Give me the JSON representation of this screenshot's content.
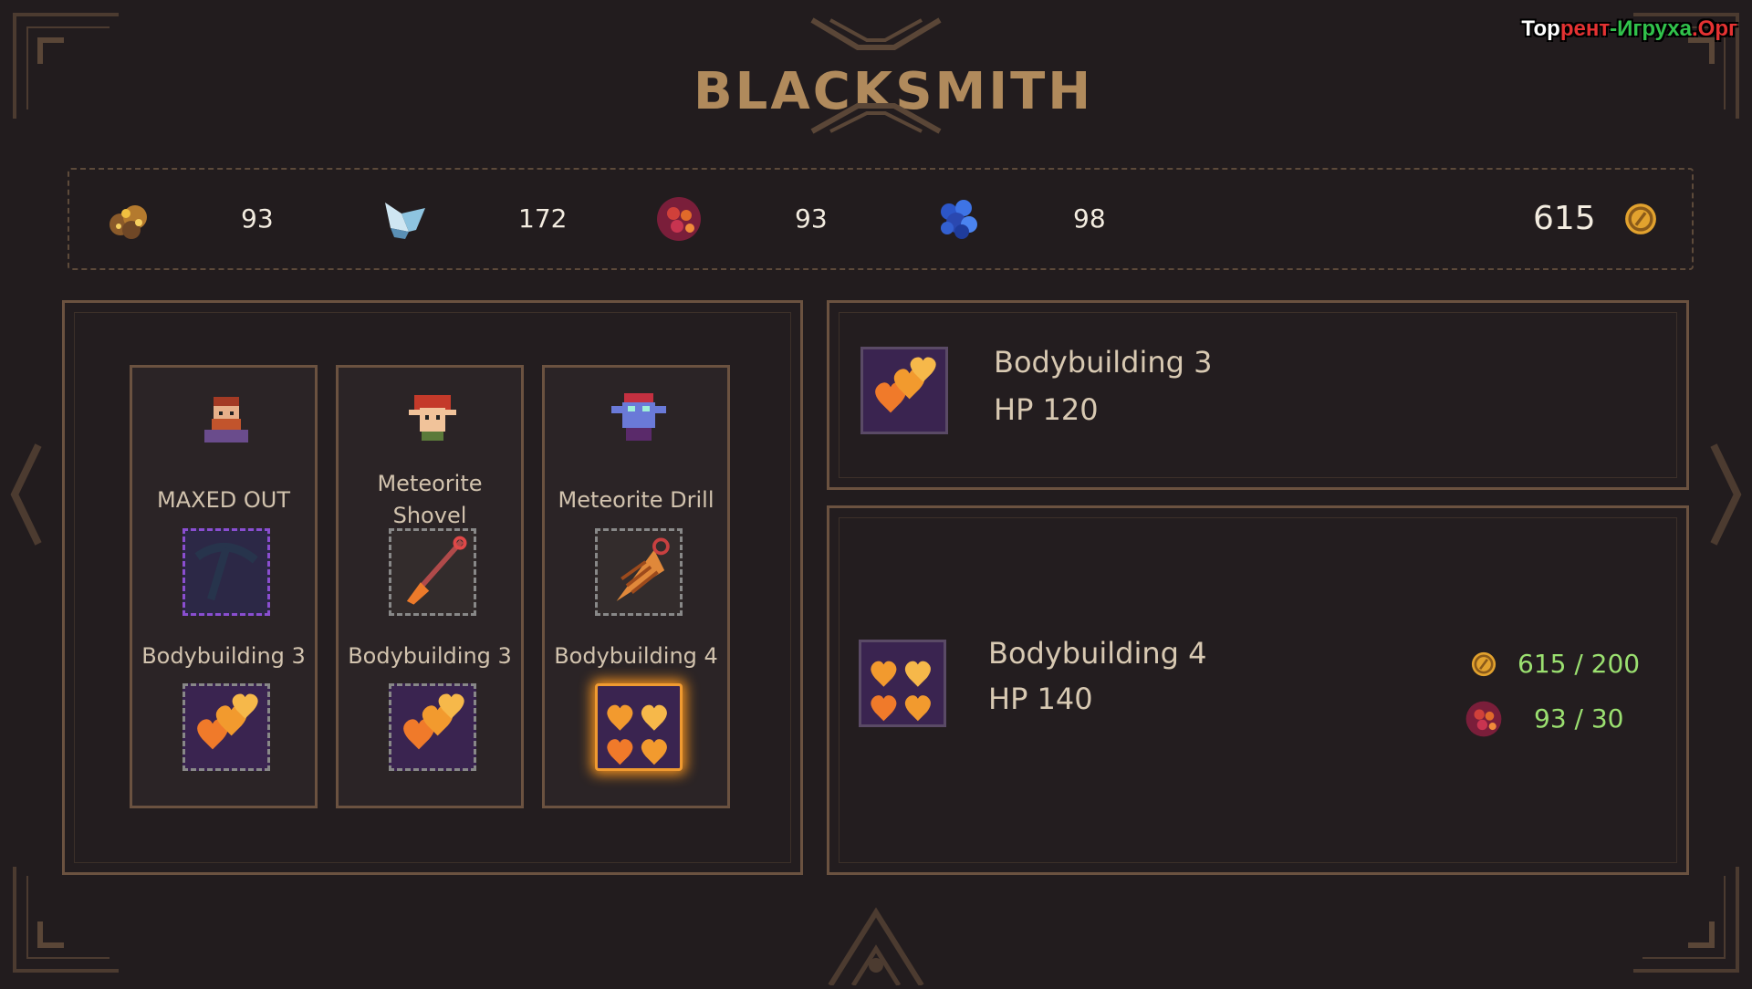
{
  "title": "BLACKSMITH",
  "watermark": {
    "part1": "Тор",
    "part2": "рент",
    "part3": "-Игруха",
    "part4": ".Орг"
  },
  "resources": {
    "gold_ore": {
      "icon": "gold-ore-icon",
      "count": "93"
    },
    "crystal": {
      "icon": "crystal-icon",
      "count": "172"
    },
    "red_ore": {
      "icon": "red-ore-icon",
      "count": "93"
    },
    "blue_gem": {
      "icon": "blue-gem-icon",
      "count": "98"
    },
    "coins": {
      "icon": "coin-icon",
      "count": "615"
    }
  },
  "characters": [
    {
      "portrait": "dwarf-portrait",
      "status": "MAXED OUT",
      "tool": "pickaxe-icon",
      "upgrade": "Bodybuilding 3",
      "upgrade_hearts": 3,
      "selected": false
    },
    {
      "portrait": "elf-portrait",
      "status": "Meteorite Shovel",
      "tool": "shovel-icon",
      "upgrade": "Bodybuilding 3",
      "upgrade_hearts": 3,
      "selected": false
    },
    {
      "portrait": "goblin-portrait",
      "status": "Meteorite Drill",
      "tool": "drill-icon",
      "upgrade": "Bodybuilding 4",
      "upgrade_hearts": 4,
      "selected": true
    }
  ],
  "current": {
    "name": "Bodybuilding 3",
    "hp": "HP 120"
  },
  "next": {
    "name": "Bodybuilding 4",
    "hp": "HP 140",
    "costs": [
      {
        "icon": "coin-icon",
        "text": "615 / 200"
      },
      {
        "icon": "red-ore-icon",
        "text": "93 / 30"
      }
    ]
  },
  "colors": {
    "accent": "#b08a5c",
    "border": "#6b5240",
    "cost_ok": "#9be070",
    "background": "#221c1e"
  }
}
